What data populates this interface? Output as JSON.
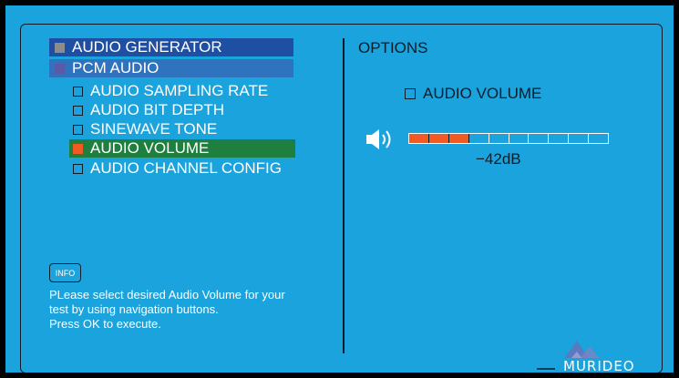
{
  "menu": {
    "items": [
      {
        "label": "AUDIO GENERATOR",
        "bg": "#1f4fa3",
        "box": "#8c8c8c"
      },
      {
        "label": "PCM AUDIO",
        "bg": "#2f73bf",
        "box": "#5a5aa8"
      }
    ],
    "sub_items": [
      {
        "label": "AUDIO SAMPLING RATE",
        "selected": false
      },
      {
        "label": "AUDIO BIT DEPTH",
        "selected": false
      },
      {
        "label": "SINEWAVE TONE",
        "selected": false
      },
      {
        "label": "AUDIO VOLUME",
        "selected": true
      },
      {
        "label": "AUDIO CHANNEL CONFIG",
        "selected": false
      }
    ],
    "selected_bg": "#1f7f3f",
    "selected_box": "#f05a23"
  },
  "info": {
    "icon_label": "INFO",
    "lines": [
      "PLease select desired Audio Volume for your",
      "test by using navigation buttons.",
      "Press OK to execute."
    ]
  },
  "options": {
    "title": "OPTIONS",
    "checkbox_label": "AUDIO VOLUME",
    "volume_level_segments": 3,
    "volume_total_segments": 10,
    "volume_readout": "−42dB"
  },
  "branding": {
    "logo_text": "MURIDEO"
  },
  "colors": {
    "background": "#1aa3dc",
    "text_dark": "#0b1d2a",
    "accent": "#f05a23"
  }
}
